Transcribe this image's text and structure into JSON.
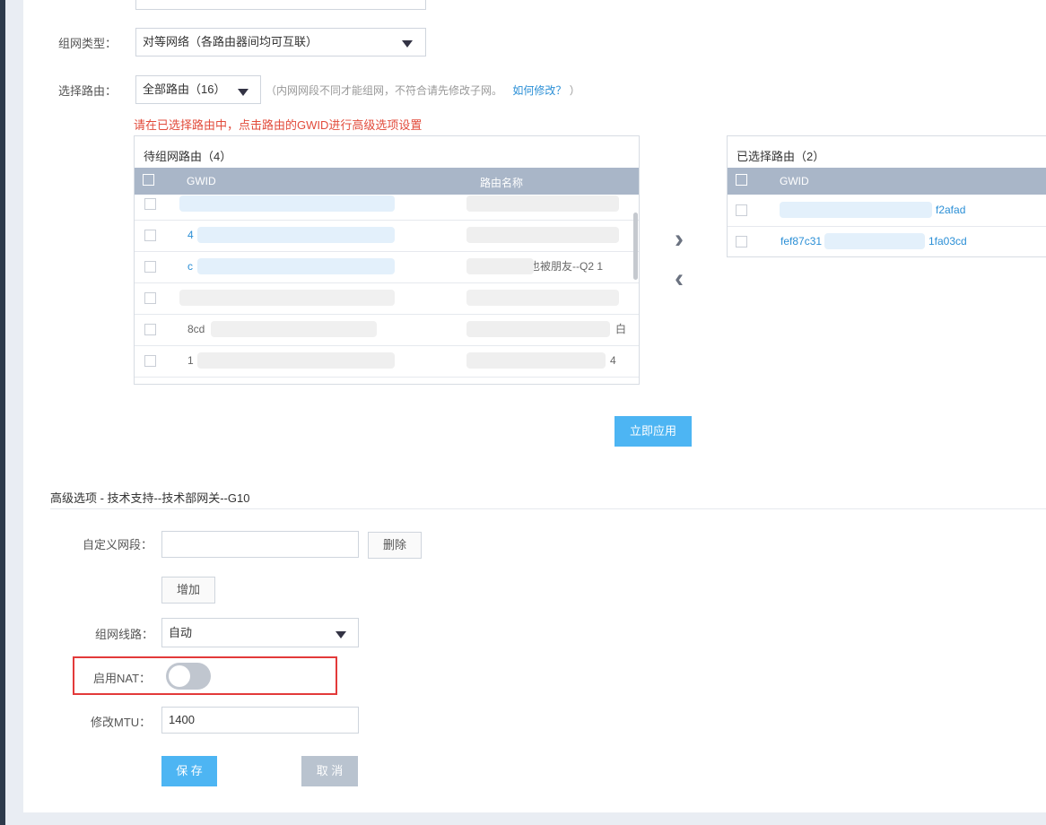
{
  "form": {
    "network_type": {
      "label": "组网类型：",
      "value": "对等网络（各路由器间均可互联）"
    },
    "select_router": {
      "label": "选择路由：",
      "value": "全部路由（16）",
      "hint_prefix": "（内网网段不同才能组网，不符合请先修改子网。",
      "hint_link": "如何修改？",
      "hint_suffix": "）"
    },
    "warning": "请在已选择路由中，点击路由的GWID进行高级选项设置"
  },
  "pending_table": {
    "title": "待组网路由（4）",
    "col_gwid": "GWID",
    "col_name": "路由名称",
    "rows": [
      {
        "gwid": "",
        "name": ""
      },
      {
        "gwid": "4",
        "name": ""
      },
      {
        "gwid": "c",
        "name": "也被朋友--Q2     1"
      },
      {
        "gwid": "",
        "name": ""
      },
      {
        "gwid": "8cd",
        "name": "白"
      },
      {
        "gwid": "1",
        "name": "4"
      }
    ]
  },
  "selected_table": {
    "title": "已选择路由（2）",
    "col_gwid": "GWID",
    "rows": [
      {
        "gwid": "f2afad"
      },
      {
        "gwid": "fef87c31",
        "gwid_tail": "1fa03cd"
      }
    ]
  },
  "transfer": {
    "move_right": "›",
    "move_left": "‹"
  },
  "apply_button": "立即应用",
  "advanced": {
    "title": "高级选项 - 技术支持--技术部网关--G10",
    "custom_segment": {
      "label": "自定义网段：",
      "value": "",
      "delete_button": "删除"
    },
    "add_button": "增加",
    "line": {
      "label": "组网线路：",
      "value": "自动"
    },
    "nat": {
      "label": "启用NAT：",
      "enabled": false
    },
    "mtu": {
      "label": "修改MTU：",
      "value": "1400"
    },
    "save_button": "保 存",
    "cancel_button": "取 消"
  },
  "colors": {
    "primary": "#4db5f3",
    "table_header": "#a9b6c8",
    "warning": "#e24b3b",
    "link": "#2b8fd6",
    "highlight": "#e33a3a"
  }
}
